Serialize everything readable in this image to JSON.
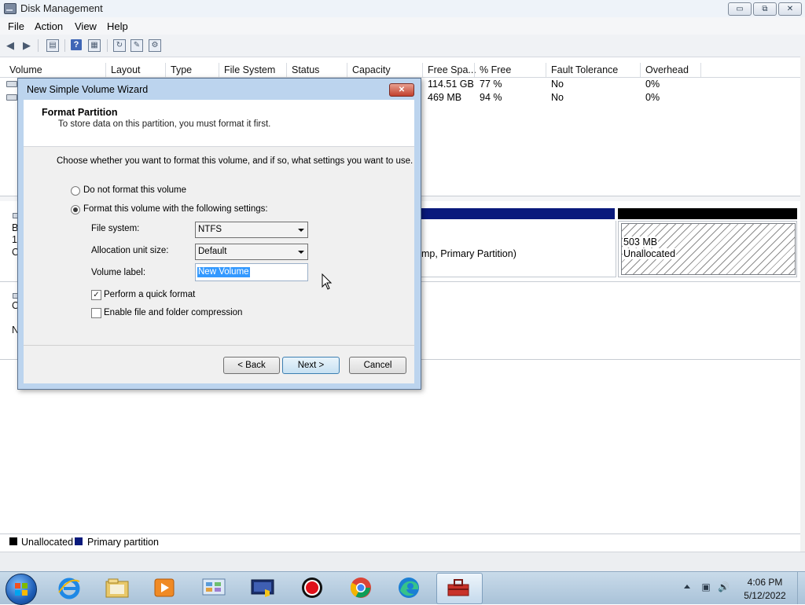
{
  "window": {
    "title": "Disk Management"
  },
  "window_controls": {
    "minimize": "▭",
    "maximize": "⧉",
    "close": "✕"
  },
  "menu": [
    "File",
    "Action",
    "View",
    "Help"
  ],
  "volume_list": {
    "columns": [
      "Volume",
      "Layout",
      "Type",
      "File System",
      "Status",
      "Capacity",
      "Free Spa...",
      "% Free",
      "Fault Tolerance",
      "Overhead"
    ],
    "rows": [
      {
        "free_space": "114.51 GB",
        "percent_free": "77 %",
        "fault_tolerance": "No",
        "overhead": "0%"
      },
      {
        "free_space": "469 MB",
        "percent_free": "94 %",
        "fault_tolerance": "No",
        "overhead": "0%"
      }
    ]
  },
  "disk_map": {
    "left_fragments": [
      "B",
      "1",
      "C",
      "C",
      "N"
    ],
    "partition_text": "mp, Primary Partition)",
    "unallocated": {
      "size": "503 MB",
      "label": "Unallocated"
    }
  },
  "legend": [
    {
      "label": "Unallocated",
      "color": "#000000"
    },
    {
      "label": "Primary partition",
      "color": "#0a1a7c"
    }
  ],
  "dialog": {
    "title": "New Simple Volume Wizard",
    "close_glyph": "✕",
    "header_title": "Format Partition",
    "header_subtitle": "To store data on this partition, you must format it first.",
    "instruction": "Choose whether you want to format this volume, and if so, what settings you want to use.",
    "option_no_format": "Do not format this volume",
    "option_format": "Format this volume with the following settings:",
    "file_system_label": "File system:",
    "file_system_value": "NTFS",
    "allocation_label": "Allocation unit size:",
    "allocation_value": "Default",
    "volume_label_label": "Volume label:",
    "volume_label_value": "New Volume",
    "quick_format_label": "Perform a quick format",
    "quick_format_checked": true,
    "compression_label": "Enable file and folder compression",
    "compression_checked": false,
    "buttons": {
      "back": "< Back",
      "next": "Next >",
      "cancel": "Cancel"
    }
  },
  "taskbar": {
    "icons": [
      "internet-explorer-icon",
      "file-explorer-icon",
      "media-player-icon",
      "control-panel-icon",
      "computer-management-icon",
      "recorder-icon",
      "chrome-icon",
      "edge-icon",
      "disk-management-icon"
    ],
    "clock_time": "4:06 PM",
    "clock_date": "5/12/2022"
  }
}
